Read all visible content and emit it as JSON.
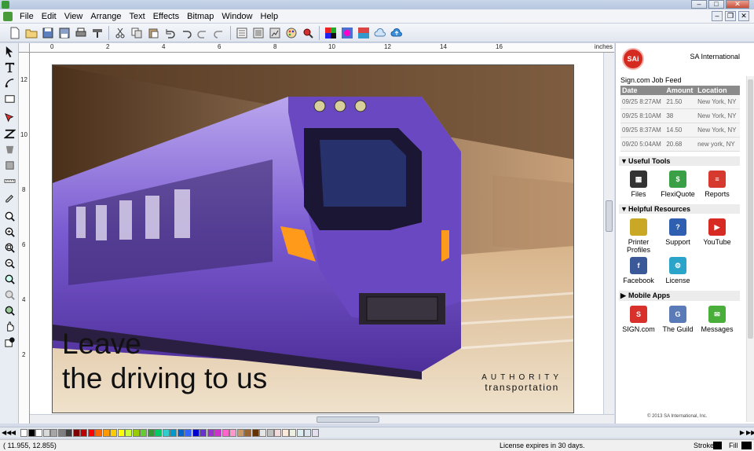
{
  "menubar": {
    "items": [
      "File",
      "Edit",
      "View",
      "Arrange",
      "Text",
      "Effects",
      "Bitmap",
      "Window",
      "Help"
    ]
  },
  "toolbar": {
    "icons": [
      "new-document-icon",
      "open-icon",
      "save-icon",
      "save-as-icon",
      "print-icon",
      "cut-plot-icon",
      "cut-icon",
      "copy-icon",
      "paste-icon",
      "undo-icon",
      "undo-more-icon",
      "redo-icon",
      "redo-more-icon",
      "import-icon",
      "export-icon",
      "clipart-icon",
      "color-palette-icon",
      "search-icon",
      "color-swatch-icon",
      "color-wheel-icon",
      "gradient-icon",
      "cloud-icon",
      "cloud-upload-icon"
    ]
  },
  "left_tools": [
    "select-arrow-icon",
    "text-tool-icon",
    "node-edit-icon",
    "rectangle-icon",
    "pen-tool-icon",
    "zigzag-icon",
    "shape-icon",
    "frame-icon",
    "measure-icon",
    "eyedropper-icon",
    "zoom-tool-icon",
    "zoom-in-icon",
    "zoom-fit-icon",
    "zoom-out-icon",
    "zoom-page-icon",
    "zoom-prev-icon",
    "zoom-all-icon",
    "pan-hand-icon",
    "fill-stroke-icon"
  ],
  "ruler": {
    "unit": "inches",
    "h_labels": [
      "0",
      "2",
      "4",
      "6",
      "8",
      "10",
      "12",
      "14",
      "16"
    ],
    "v_labels": [
      "12",
      "10",
      "8",
      "6",
      "4",
      "2"
    ]
  },
  "artwork": {
    "headline_line1": "Leave",
    "headline_line2": "the driving to us",
    "brand_line1": "AUTHORITY",
    "brand_line2": "transportation"
  },
  "panel": {
    "company": "SA International",
    "logo_text": "SAi",
    "feed_title": "Sign.com Job Feed",
    "feed_headers": [
      "Date",
      "Amount",
      "Location"
    ],
    "feed_rows": [
      [
        "09/25 8:27AM",
        "21.50",
        "New York, NY"
      ],
      [
        "09/25 8:10AM",
        "38",
        "New York, NY"
      ],
      [
        "09/25 8:37AM",
        "14.50",
        "New York, NY"
      ],
      [
        "09/20 5:04AM",
        "20.68",
        "new york, NY"
      ]
    ],
    "useful_tools_title": "Useful Tools",
    "useful_tools": [
      {
        "label": "Files",
        "icon": "files-icon",
        "color": "#333333"
      },
      {
        "label": "FlexiQuote",
        "icon": "flexiquote-icon",
        "color": "#3aa046"
      },
      {
        "label": "Reports",
        "icon": "reports-icon",
        "color": "#d63a2e"
      }
    ],
    "helpful_title": "Helpful Resources",
    "helpful": [
      {
        "label": "Printer Profiles",
        "icon": "printer-profiles-icon",
        "color": "#c9a826"
      },
      {
        "label": "Support",
        "icon": "support-icon",
        "color": "#2f5fb0"
      },
      {
        "label": "YouTube",
        "icon": "youtube-icon",
        "color": "#d62a22"
      },
      {
        "label": "Facebook",
        "icon": "facebook-icon",
        "color": "#3b5998"
      },
      {
        "label": "License",
        "icon": "license-icon",
        "color": "#2aa4c8"
      }
    ],
    "mobile_title": "Mobile Apps",
    "mobile": [
      {
        "label": "SIGN.com",
        "icon": "sign-com-icon",
        "color": "#d8302a"
      },
      {
        "label": "The Guild",
        "icon": "the-guild-icon",
        "color": "#5a7ab8"
      },
      {
        "label": "Messages",
        "icon": "messages-icon",
        "color": "#4aae3a"
      }
    ],
    "copyright": "© 2013 SA International, Inc."
  },
  "palette_colors": [
    "#ffffff",
    "#000000",
    "#ffffff",
    "#d9d9d9",
    "#a6a6a6",
    "#7f7f7f",
    "#404040",
    "#7f0000",
    "#c00000",
    "#ff0000",
    "#ff6600",
    "#ff9900",
    "#ffcc00",
    "#ffff00",
    "#ccff33",
    "#99cc00",
    "#66cc33",
    "#339933",
    "#00cc66",
    "#33cccc",
    "#0099cc",
    "#0066cc",
    "#3366ff",
    "#0000cc",
    "#6633cc",
    "#9933cc",
    "#cc33cc",
    "#ff66cc",
    "#ff99cc",
    "#cc9966",
    "#996633",
    "#663300",
    "#e6e6e6",
    "#bfbfbf",
    "#f2dcdb",
    "#fde9d9",
    "#ebf1de",
    "#dbeef3",
    "#dce6f1",
    "#e4dfec"
  ],
  "status": {
    "coords": "( 11.955,     12.855)",
    "license": "License expires in 30 days.",
    "stroke": "Stroke",
    "fill": "Fill"
  }
}
